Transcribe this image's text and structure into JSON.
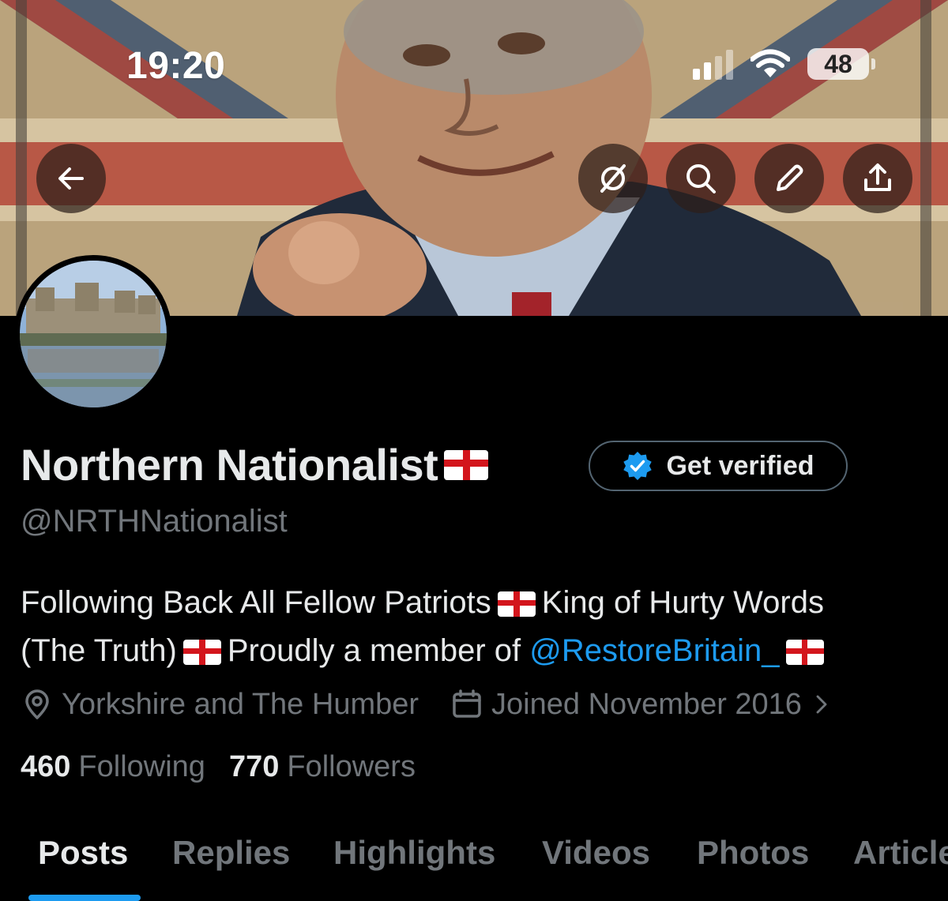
{
  "status_bar": {
    "time": "19:20",
    "battery": "48",
    "icons": [
      "cellular-signal-icon",
      "wifi-icon",
      "battery-icon"
    ]
  },
  "header_actions": {
    "icons": [
      "back-arrow-icon",
      "grok-icon",
      "search-icon",
      "edit-pencil-icon",
      "share-icon"
    ]
  },
  "profile": {
    "display_name": "Northern Nationalist",
    "handle": "@NRTHNationalist",
    "verify_button_label": "Get verified",
    "bio": {
      "line1_a": "Following Back All Fellow Patriots",
      "line1_b": "King of Hurty Words",
      "line2_a": "(The Truth)",
      "line2_b": "Proudly a member of",
      "mention": "@RestoreBritain_"
    },
    "location": "Yorkshire and The Humber",
    "joined": "Joined November 2016",
    "following_count": "460",
    "following_label": "Following",
    "followers_count": "770",
    "followers_label": "Followers"
  },
  "tabs": [
    "Posts",
    "Replies",
    "Highlights",
    "Videos",
    "Photos",
    "Articles"
  ],
  "active_tab": "Posts",
  "colors": {
    "background": "#000000",
    "accent": "#1d9bf0",
    "muted_text": "#71767b",
    "primary_text": "#e7e9ea",
    "flag_red": "#d3151c"
  }
}
